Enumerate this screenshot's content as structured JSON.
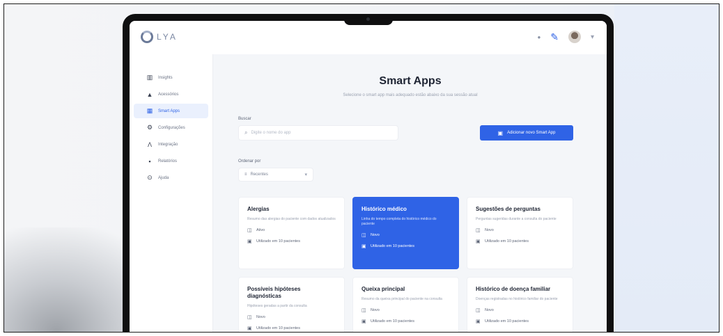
{
  "app": {
    "logo_text": "LYA"
  },
  "sidebar": {
    "items": [
      {
        "label": "Insights",
        "icon": "chart-icon"
      },
      {
        "label": "Acessórios",
        "icon": "triangle-icon"
      },
      {
        "label": "Smart Apps",
        "icon": "grid-icon",
        "active": true
      },
      {
        "label": "Configurações",
        "icon": "gear-icon"
      },
      {
        "label": "Integração",
        "icon": "link-icon"
      },
      {
        "label": "Relatórios",
        "icon": "file-icon"
      },
      {
        "label": "Ajuda",
        "icon": "help-icon"
      }
    ]
  },
  "main": {
    "title": "Smart Apps",
    "subtitle": "Selecione o smart app mais adequado estão abaixo da sua sessão atual",
    "search_label": "Buscar",
    "search_placeholder": "Digite o nome do app",
    "cta_label": "Adicionar novo Smart App",
    "sort_label": "Ordenar por",
    "sort_value": "Recentes"
  },
  "cards": [
    {
      "title": "Alergias",
      "desc": "Resumo das alergias do paciente com dados atualizados",
      "meta1": "Ativo",
      "meta2": "Utilizado em 10 pacientes",
      "selected": false
    },
    {
      "title": "Histórico médico",
      "desc": "Linha do tempo completa do histórico médico do paciente",
      "meta1": "Novo",
      "meta2": "Utilizado em 10 pacientes",
      "selected": true
    },
    {
      "title": "Sugestões de perguntas",
      "desc": "Perguntas sugeridas durante a consulta do paciente",
      "meta1": "Novo",
      "meta2": "Utilizado em 10 pacientes",
      "selected": false
    },
    {
      "title": "Possíveis hipóteses diagnósticas",
      "desc": "Hipóteses geradas a partir da consulta",
      "meta1": "Novo",
      "meta2": "Utilizado em 10 pacientes",
      "selected": false
    },
    {
      "title": "Queixa principal",
      "desc": "Resumo da queixa principal do paciente na consulta",
      "meta1": "Novo",
      "meta2": "Utilizado em 10 pacientes",
      "selected": false
    },
    {
      "title": "Histórico de doença familiar",
      "desc": "Doenças registradas no histórico familiar do paciente",
      "meta1": "Novo",
      "meta2": "Utilizado em 10 pacientes",
      "selected": false
    }
  ],
  "colors": {
    "accent": "#2f63e6",
    "background": "#f4f6f9"
  }
}
